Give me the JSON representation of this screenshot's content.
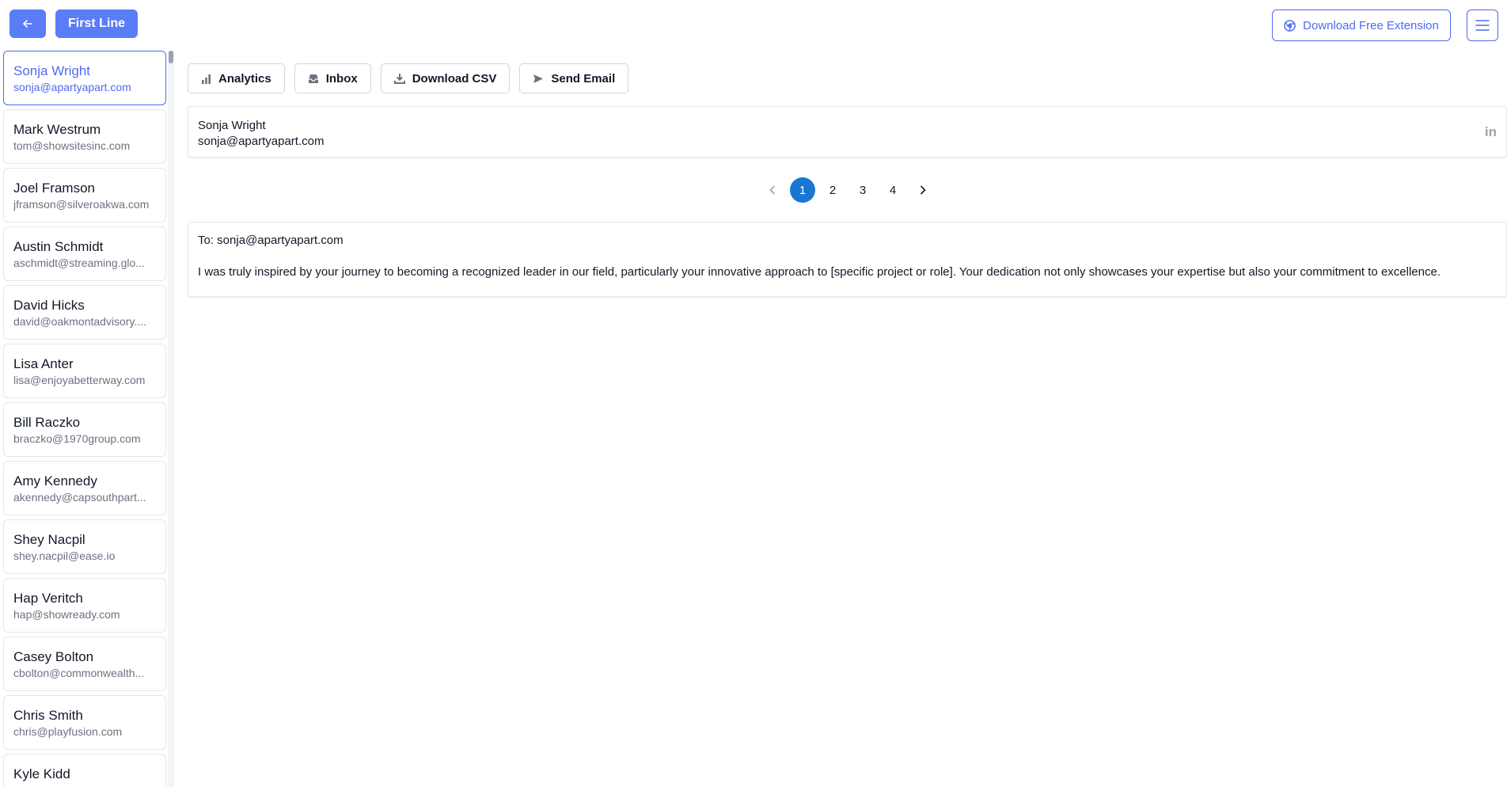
{
  "header": {
    "first_line_label": "First Line",
    "download_extension_label": "Download Free Extension"
  },
  "contacts": [
    {
      "name": "Sonja Wright",
      "email": "sonja@apartyapart.com",
      "selected": true
    },
    {
      "name": "Mark Westrum",
      "email": "tom@showsitesinc.com"
    },
    {
      "name": "Joel Framson",
      "email": "jframson@silveroakwa.com"
    },
    {
      "name": "Austin Schmidt",
      "email": "aschmidt@streaming.glo..."
    },
    {
      "name": "David Hicks",
      "email": "david@oakmontadvisory...."
    },
    {
      "name": "Lisa Anter",
      "email": "lisa@enjoyabetterway.com"
    },
    {
      "name": "Bill Raczko",
      "email": "braczko@1970group.com"
    },
    {
      "name": "Amy Kennedy",
      "email": "akennedy@capsouthpart..."
    },
    {
      "name": "Shey Nacpil",
      "email": "shey.nacpil@ease.io"
    },
    {
      "name": "Hap Veritch",
      "email": "hap@showready.com"
    },
    {
      "name": "Casey Bolton",
      "email": "cbolton@commonwealth..."
    },
    {
      "name": "Chris Smith",
      "email": "chris@playfusion.com"
    },
    {
      "name": "Kyle Kidd",
      "email": ""
    }
  ],
  "toolbar": {
    "analytics_label": "Analytics",
    "inbox_label": "Inbox",
    "download_csv_label": "Download CSV",
    "send_email_label": "Send Email"
  },
  "selected_contact": {
    "name": "Sonja Wright",
    "email": "sonja@apartyapart.com",
    "linkedin_label": "in"
  },
  "pagination": {
    "pages": [
      "1",
      "2",
      "3",
      "4"
    ],
    "current": "1"
  },
  "email": {
    "to_line": "To: sonja@apartyapart.com",
    "body": "I was truly inspired by your journey to becoming a recognized leader in our field, particularly your innovative approach to [specific project or role]. Your dedication not only showcases your expertise but also your commitment to excellence."
  },
  "colors": {
    "accent": "#5b7cf7",
    "accent_border": "#4f6bed",
    "pager_active": "#1976d2"
  }
}
